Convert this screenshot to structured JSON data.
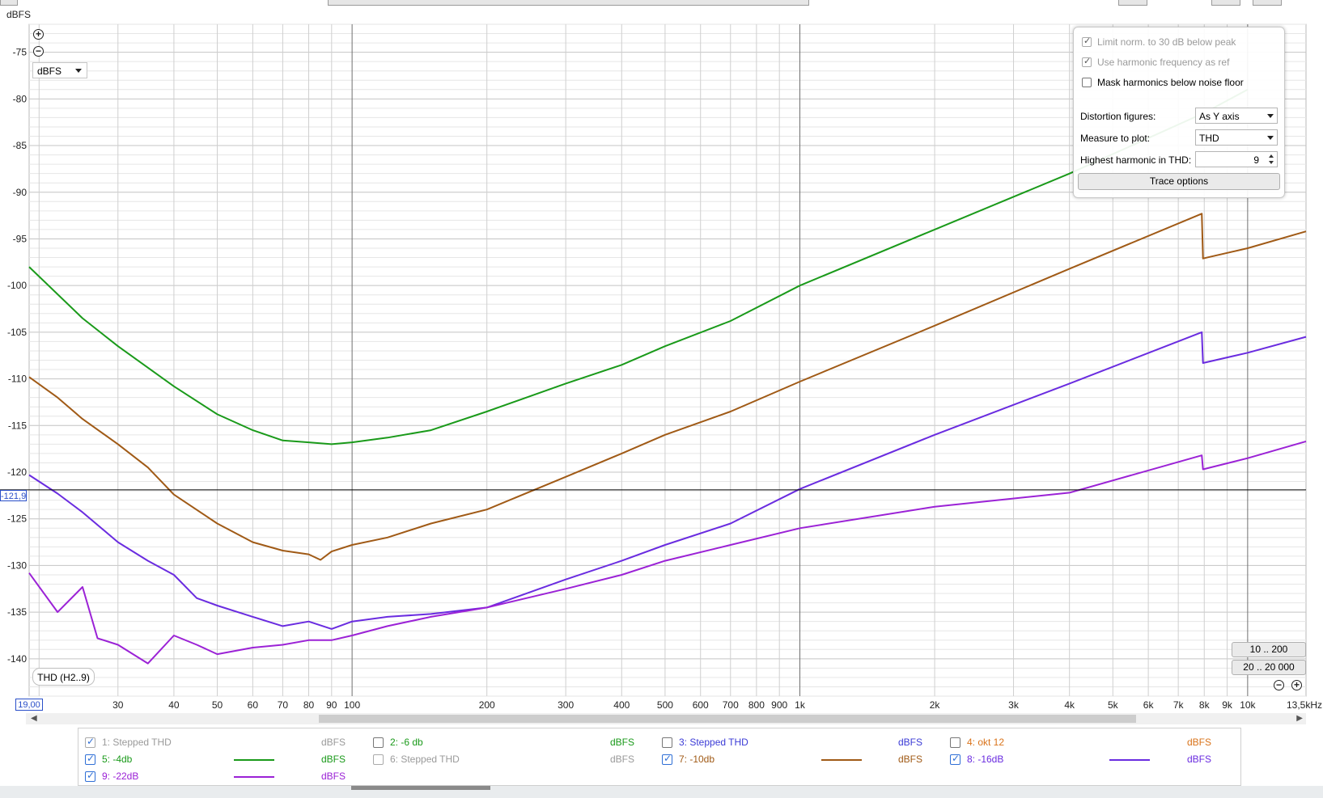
{
  "chart_data": {
    "type": "line",
    "title": "",
    "xlabel": "",
    "ylabel": "dBFS",
    "x_scale": "log",
    "xlim": [
      19,
      13500
    ],
    "ylim": [
      -144,
      -72
    ],
    "y_ticks": [
      -75,
      -80,
      -85,
      -90,
      -95,
      -100,
      -105,
      -110,
      -115,
      -120,
      -125,
      -130,
      -135,
      -140
    ],
    "y_tick_labels": [
      "-75",
      "-80",
      "-85",
      "-90",
      "-95",
      "-100",
      "-105",
      "-110",
      "-115",
      "-120",
      "-125",
      "-130",
      "-135",
      "-140"
    ],
    "x_ticks": [
      30,
      40,
      50,
      60,
      70,
      80,
      90,
      100,
      200,
      300,
      400,
      500,
      600,
      700,
      800,
      900,
      1000,
      2000,
      3000,
      4000,
      5000,
      6000,
      7000,
      8000,
      9000,
      10000
    ],
    "x_tick_labels": [
      "30",
      "40",
      "50",
      "60",
      "70",
      "80",
      "90",
      "100",
      "200",
      "300",
      "400",
      "500",
      "600",
      "700",
      "800",
      "900",
      "1k",
      "2k",
      "3k",
      "4k",
      "5k",
      "6k",
      "7k",
      "8k",
      "9k",
      "10k"
    ],
    "x_end_label": "13,5kHz",
    "cursor_y": -121.9,
    "series": [
      {
        "name": "5: -4db",
        "color": "#1a9a1a",
        "x": [
          19,
          25,
          30,
          40,
          50,
          60,
          70,
          80,
          90,
          100,
          120,
          150,
          200,
          300,
          400,
          500,
          700,
          1000,
          2000,
          4000,
          8000,
          10000
        ],
        "y": [
          -98,
          -103.5,
          -106.5,
          -110.8,
          -113.8,
          -115.5,
          -116.6,
          -116.8,
          -117,
          -116.8,
          -116.3,
          -115.5,
          -113.5,
          -110.5,
          -108.5,
          -106.5,
          -103.8,
          -100,
          -94,
          -88,
          -81.5,
          -79
        ]
      },
      {
        "name": "7: -10db",
        "color": "#a05a16",
        "x": [
          19,
          22,
          25,
          30,
          35,
          40,
          50,
          60,
          70,
          80,
          85,
          90,
          100,
          120,
          150,
          200,
          300,
          400,
          500,
          700,
          1000,
          2000,
          4000,
          7900,
          7950,
          10000,
          13500
        ],
        "y": [
          -109.8,
          -112,
          -114.3,
          -117,
          -119.5,
          -122.4,
          -125.5,
          -127.5,
          -128.4,
          -128.8,
          -129.4,
          -128.5,
          -127.8,
          -127,
          -125.5,
          -124,
          -120.5,
          -118,
          -116,
          -113.5,
          -110.3,
          -104.3,
          -98.2,
          -92.3,
          -97.1,
          -96,
          -94.2
        ]
      },
      {
        "name": "8: -16dB",
        "color": "#6a2ce0",
        "x": [
          19,
          22,
          25,
          30,
          35,
          40,
          45,
          50,
          60,
          70,
          80,
          90,
          100,
          120,
          150,
          200,
          300,
          400,
          500,
          700,
          1000,
          2000,
          4000,
          7900,
          7950,
          10000,
          13500
        ],
        "y": [
          -120.3,
          -122.3,
          -124.3,
          -127.5,
          -129.5,
          -131,
          -133.5,
          -134.3,
          -135.5,
          -136.5,
          -136,
          -136.8,
          -136,
          -135.5,
          -135.2,
          -134.5,
          -131.5,
          -129.5,
          -127.8,
          -125.5,
          -121.8,
          -116,
          -110.5,
          -105,
          -108.3,
          -107.2,
          -105.5
        ]
      },
      {
        "name": "9: -22dB",
        "color": "#9b22d6",
        "x": [
          19,
          22,
          25,
          27,
          30,
          35,
          40,
          45,
          50,
          60,
          70,
          80,
          90,
          100,
          120,
          150,
          200,
          300,
          400,
          500,
          700,
          1000,
          2000,
          4000,
          7900,
          7950,
          10000,
          13500
        ],
        "y": [
          -130.8,
          -135,
          -132.3,
          -137.8,
          -138.5,
          -140.5,
          -137.5,
          -138.5,
          -139.5,
          -138.8,
          -138.5,
          -138,
          -138,
          -137.5,
          -136.5,
          -135.5,
          -134.5,
          -132.5,
          -131,
          -129.5,
          -127.8,
          -126,
          -123.7,
          -122.2,
          -118.2,
          -119.7,
          -118.5,
          -116.7
        ]
      }
    ]
  },
  "axis": {
    "y_title": "dBFS",
    "unit_selector": "dBFS"
  },
  "readouts": {
    "cursor_value": "-121,9",
    "x_start": "19,00"
  },
  "trace_label": "THD (H2..9)",
  "range_buttons": {
    "r1": "10 .. 200",
    "r2": "20 .. 20 000"
  },
  "options": {
    "limit_norm": "Limit norm. to 30 dB below peak",
    "use_harmonic": "Use harmonic frequency as ref",
    "mask_harmonics": "Mask harmonics below noise floor",
    "distortion_label": "Distortion figures:",
    "distortion_value": "As Y axis",
    "measure_label": "Measure to plot:",
    "measure_value": "THD",
    "highest_label": "Highest harmonic in THD:",
    "highest_value": "9",
    "trace_options": "Trace options"
  },
  "legend": [
    {
      "label": "1: Stepped THD",
      "unit": "dBFS",
      "checked": true,
      "active": false,
      "color": "#9a9a9a",
      "unit_color": "#9a9a9a",
      "line": false
    },
    {
      "label": "2: -6 db",
      "unit": "dBFS",
      "checked": false,
      "active": true,
      "color": "#1a9a1a",
      "unit_color": "#1a9a1a",
      "line": false
    },
    {
      "label": "3: Stepped THD",
      "unit": "dBFS",
      "checked": false,
      "active": true,
      "color": "#3b3bd6",
      "unit_color": "#3b3bd6",
      "line": false
    },
    {
      "label": "4: okt 12",
      "unit": "dBFS",
      "checked": false,
      "active": true,
      "color": "#d9731a",
      "unit_color": "#d9731a",
      "line": false
    },
    {
      "label": "5: -4db",
      "unit": "dBFS",
      "checked": true,
      "active": true,
      "color": "#1a9a1a",
      "unit_color": "#1a9a1a",
      "line": true
    },
    {
      "label": "6: Stepped THD",
      "unit": "dBFS",
      "checked": false,
      "active": false,
      "color": "#9a9a9a",
      "unit_color": "#9a9a9a",
      "line": false
    },
    {
      "label": "7: -10db",
      "unit": "dBFS",
      "checked": true,
      "active": true,
      "color": "#a05a16",
      "unit_color": "#a05a16",
      "line": true
    },
    {
      "label": "8: -16dB",
      "unit": "dBFS",
      "checked": true,
      "active": true,
      "color": "#6a2ce0",
      "unit_color": "#6a2ce0",
      "line": true
    },
    {
      "label": "9: -22dB",
      "unit": "dBFS",
      "checked": true,
      "active": true,
      "color": "#9b22d6",
      "unit_color": "#9b22d6",
      "line": true
    }
  ]
}
